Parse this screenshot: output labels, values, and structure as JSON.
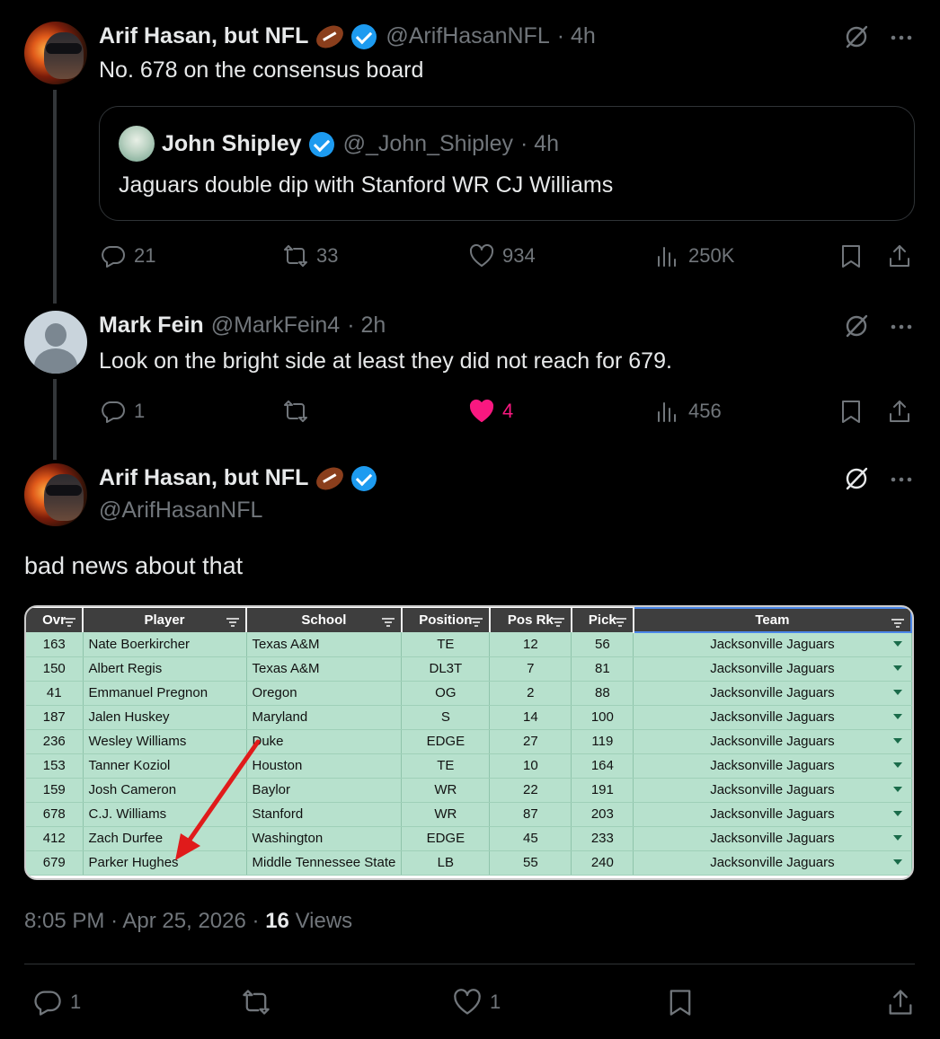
{
  "tweet1": {
    "name": "Arif Hasan, but NFL",
    "handle": "@ArifHasanNFL",
    "time": "· 4h",
    "text": "No. 678 on the consensus board",
    "quote": {
      "name": "John Shipley",
      "handle": "@_John_Shipley",
      "time": "· 4h",
      "text": "Jaguars double dip with Stanford WR CJ Williams"
    },
    "stats": {
      "replies": "21",
      "reposts": "33",
      "likes": "934",
      "views": "250K"
    }
  },
  "tweet2": {
    "name": "Mark Fein",
    "handle": "@MarkFein4",
    "time": "· 2h",
    "text": "Look on the bright side at least they did not reach for 679.",
    "stats": {
      "replies": "1",
      "reposts": "",
      "likes": "4",
      "views": "456"
    }
  },
  "main": {
    "name": "Arif Hasan, but NFL",
    "handle": "@ArifHasanNFL",
    "text": "bad news about that",
    "time": "8:05 PM",
    "date": "Apr 25, 2026",
    "views_count": "16",
    "views_label": "Views",
    "stats": {
      "replies": "1",
      "likes": "1"
    }
  },
  "sheet": {
    "headers": [
      "Ovr",
      "Player",
      "School",
      "Position",
      "Pos Rk",
      "Pick",
      "Team"
    ],
    "rows": [
      [
        "163",
        "Nate Boerkircher",
        "Texas A&M",
        "TE",
        "12",
        "56",
        "Jacksonville Jaguars"
      ],
      [
        "150",
        "Albert Regis",
        "Texas A&M",
        "DL3T",
        "7",
        "81",
        "Jacksonville Jaguars"
      ],
      [
        "41",
        "Emmanuel Pregnon",
        "Oregon",
        "OG",
        "2",
        "88",
        "Jacksonville Jaguars"
      ],
      [
        "187",
        "Jalen Huskey",
        "Maryland",
        "S",
        "14",
        "100",
        "Jacksonville Jaguars"
      ],
      [
        "236",
        "Wesley Williams",
        "Duke",
        "EDGE",
        "27",
        "119",
        "Jacksonville Jaguars"
      ],
      [
        "153",
        "Tanner Koziol",
        "Houston",
        "TE",
        "10",
        "164",
        "Jacksonville Jaguars"
      ],
      [
        "159",
        "Josh Cameron",
        "Baylor",
        "WR",
        "22",
        "191",
        "Jacksonville Jaguars"
      ],
      [
        "678",
        "C.J. Williams",
        "Stanford",
        "WR",
        "87",
        "203",
        "Jacksonville Jaguars"
      ],
      [
        "412",
        "Zach Durfee",
        "Washington",
        "EDGE",
        "45",
        "233",
        "Jacksonville Jaguars"
      ],
      [
        "679",
        "Parker Hughes",
        "Middle Tennessee State",
        "LB",
        "55",
        "240",
        "Jacksonville Jaguars"
      ]
    ]
  },
  "colors": {
    "like": "#f91880",
    "verified": "#1d9bf0",
    "sheet_row": "#b7e1cd",
    "arrow": "#e01b1b"
  }
}
